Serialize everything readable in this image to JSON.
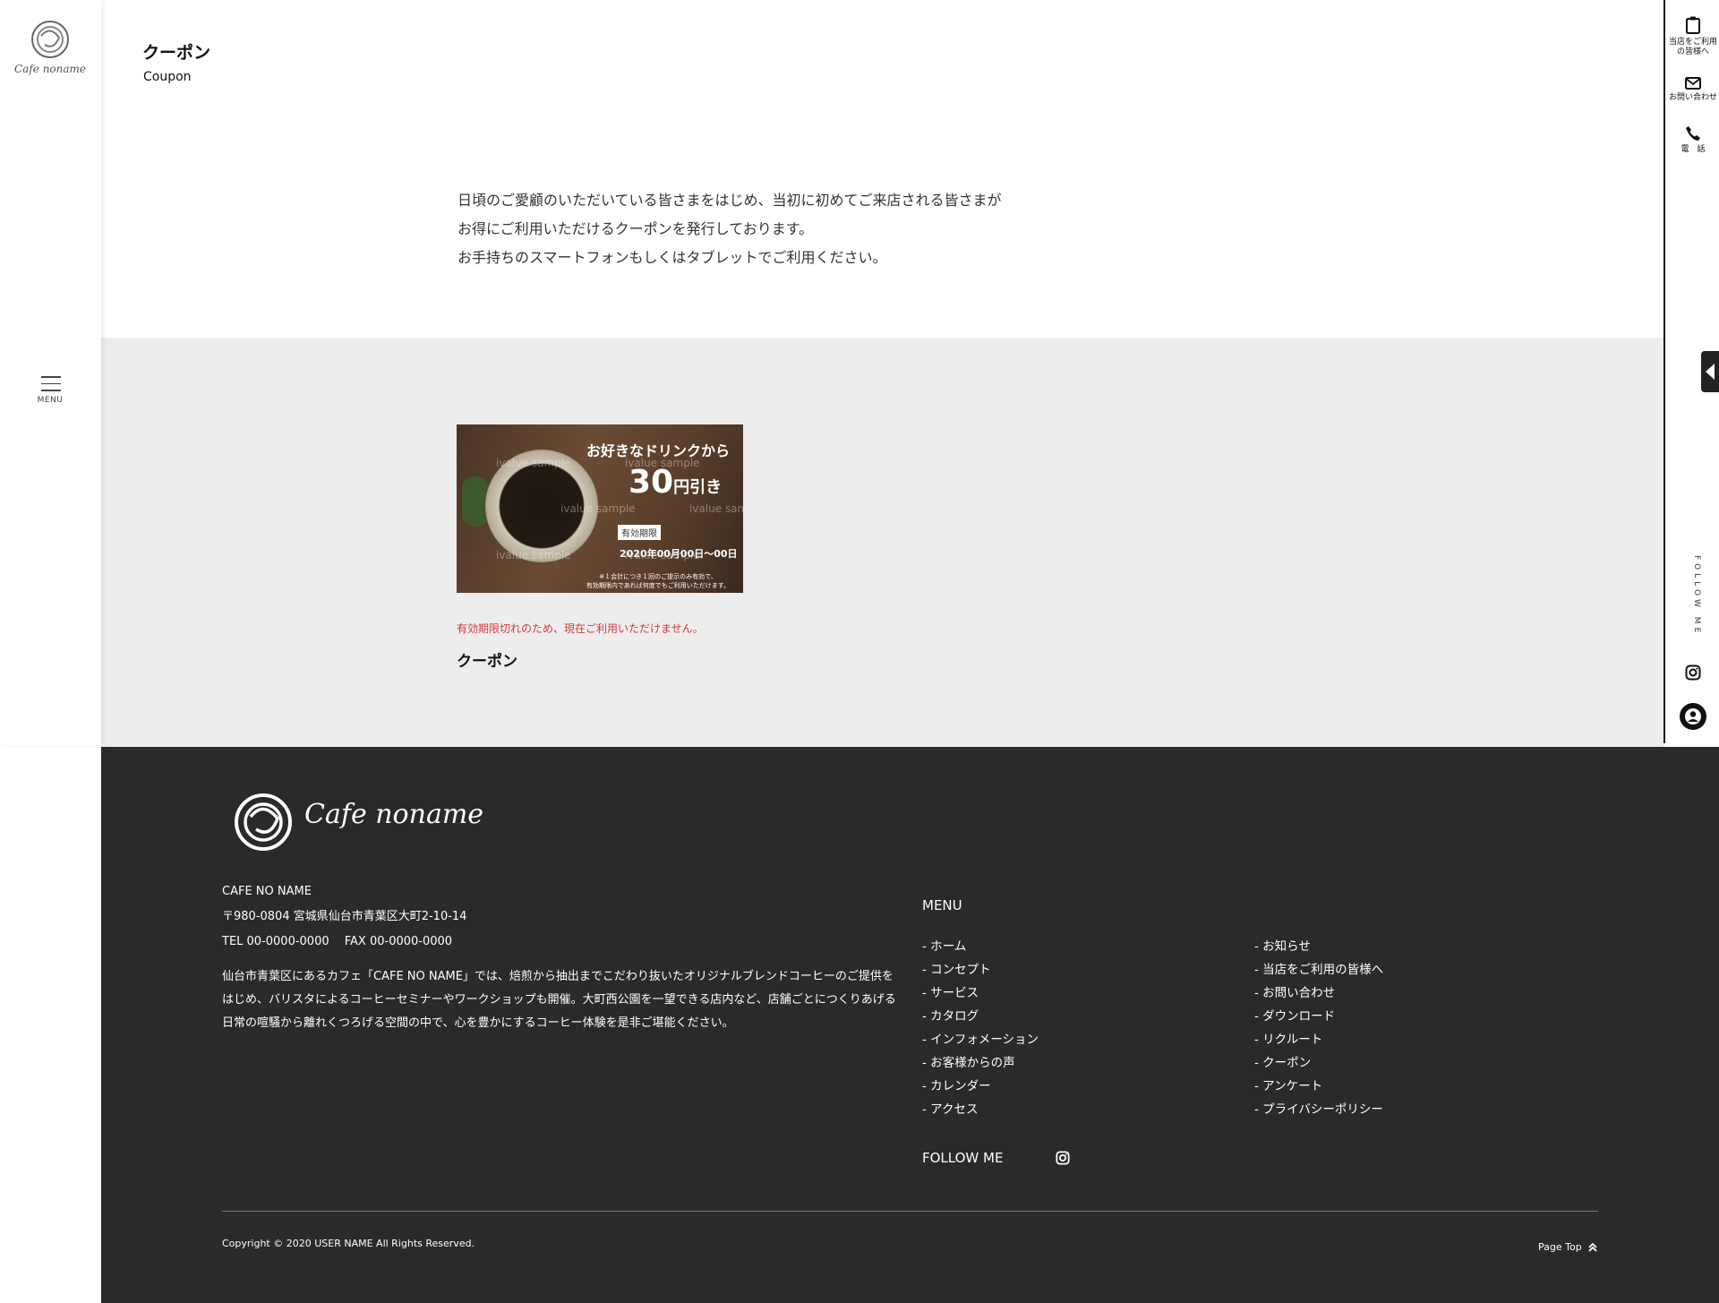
{
  "sidebar_left": {
    "logo_text": "Cafe noname",
    "menu_label": "MENU"
  },
  "sidebar_right": {
    "items": [
      {
        "label_line1": "当店をご利用",
        "label_line2": "の皆様へ",
        "icon": "clipboard-icon"
      },
      {
        "label_line1": "お問い合わせ",
        "label_line2": "",
        "icon": "mail-icon"
      },
      {
        "label_line1": "電　話",
        "label_line2": "",
        "icon": "phone-icon"
      }
    ],
    "follow_label": "FOLLOW ME"
  },
  "header": {
    "title": "クーポン",
    "subtitle": "Coupon"
  },
  "intro": {
    "lines": [
      "日頃のご愛顧のいただいている皆さまをはじめ、当初に初めてご来店される皆さまが",
      "お得にご利用いただけるクーポンを発行しております。",
      "お手持ちのスマートフォンもしくはタブレットでご利用ください。"
    ]
  },
  "coupon": {
    "headline": "お好きなドリンクから",
    "amount": "30",
    "amount_suffix": "円引き",
    "validity_label": "有効期限",
    "validity_date": "2020年00月00日〜00日",
    "note_line1": "※１会計につき１回のご提示のみ有効で、",
    "note_line2": "有効期限内であれば何度でもご利用いただけます。",
    "watermark": "ivalue sample",
    "expired_notice": "有効期限切れのため、現在ご利用いただけません。",
    "name": "クーポン"
  },
  "footer": {
    "logo_text": "Cafe noname",
    "company": "CAFE NO NAME",
    "address": "〒980-0804  宮城県仙台市青葉区大町2-10-14",
    "phone": "TEL 00-0000-0000　 FAX 00-0000-0000",
    "description": "仙台市青葉区にあるカフェ「CAFE NO NAME」では、焙煎から抽出までこだわり抜いたオリジナルブレンドコーヒーのご提供をはじめ、バリスタによるコーヒーセミナーやワークショップも開催。大町西公園を一望できる店内など、店舗ごとにつくりあげる日常の喧騒から離れくつろげる空間の中で、心を豊かにするコーヒー体験を是非ご堪能ください。",
    "menu_heading": "MENU",
    "menu_col1": [
      "- ホーム",
      "- コンセプト",
      "- サービス",
      "- カタログ",
      "- インフォメーション",
      "- お客様からの声",
      "- カレンダー",
      "- アクセス"
    ],
    "menu_col2": [
      "- お知らせ",
      "- 当店をご利用の皆様へ",
      "- お問い合わせ",
      "- ダウンロード",
      "- リクルート",
      "- クーポン",
      "- アンケート",
      "- プライバシーポリシー"
    ],
    "follow_label": "FOLLOW ME",
    "copyright": "Copyright © 2020 USER NAME All Rights Reserved.",
    "page_top": "Page Top"
  }
}
